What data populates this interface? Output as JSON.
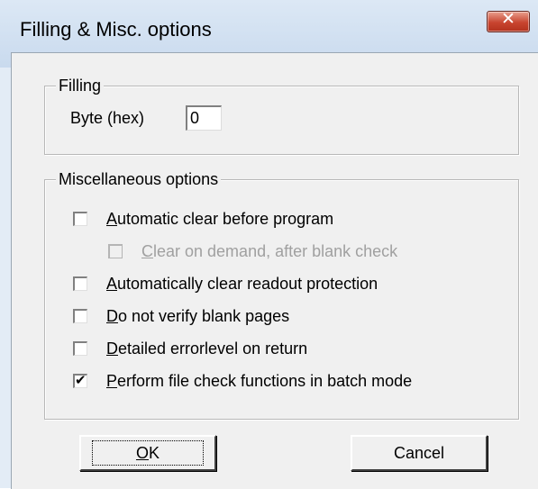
{
  "window": {
    "title": "Filling & Misc. options",
    "close_glyph": "✕"
  },
  "filling": {
    "legend": "Filling",
    "byte_label": "Byte (hex)",
    "byte_value": "0"
  },
  "misc": {
    "legend": "Miscellaneous options",
    "options": [
      {
        "mnemonic": "A",
        "rest": "utomatic clear before program",
        "checked": false,
        "disabled": false
      },
      {
        "mnemonic": "C",
        "rest": "lear on demand, after blank check",
        "checked": false,
        "disabled": true
      },
      {
        "mnemonic": "A",
        "rest": "utomatically clear readout protection",
        "checked": false,
        "disabled": false
      },
      {
        "mnemonic": "D",
        "rest": "o not verify blank pages",
        "checked": false,
        "disabled": false
      },
      {
        "mnemonic": "D",
        "rest": "etailed errorlevel on return",
        "checked": false,
        "disabled": false
      },
      {
        "mnemonic": "P",
        "rest": "erform file check functions in batch mode",
        "checked": true,
        "disabled": false
      }
    ]
  },
  "buttons": {
    "ok_mnemonic": "O",
    "ok_rest": "K",
    "cancel": "Cancel"
  }
}
